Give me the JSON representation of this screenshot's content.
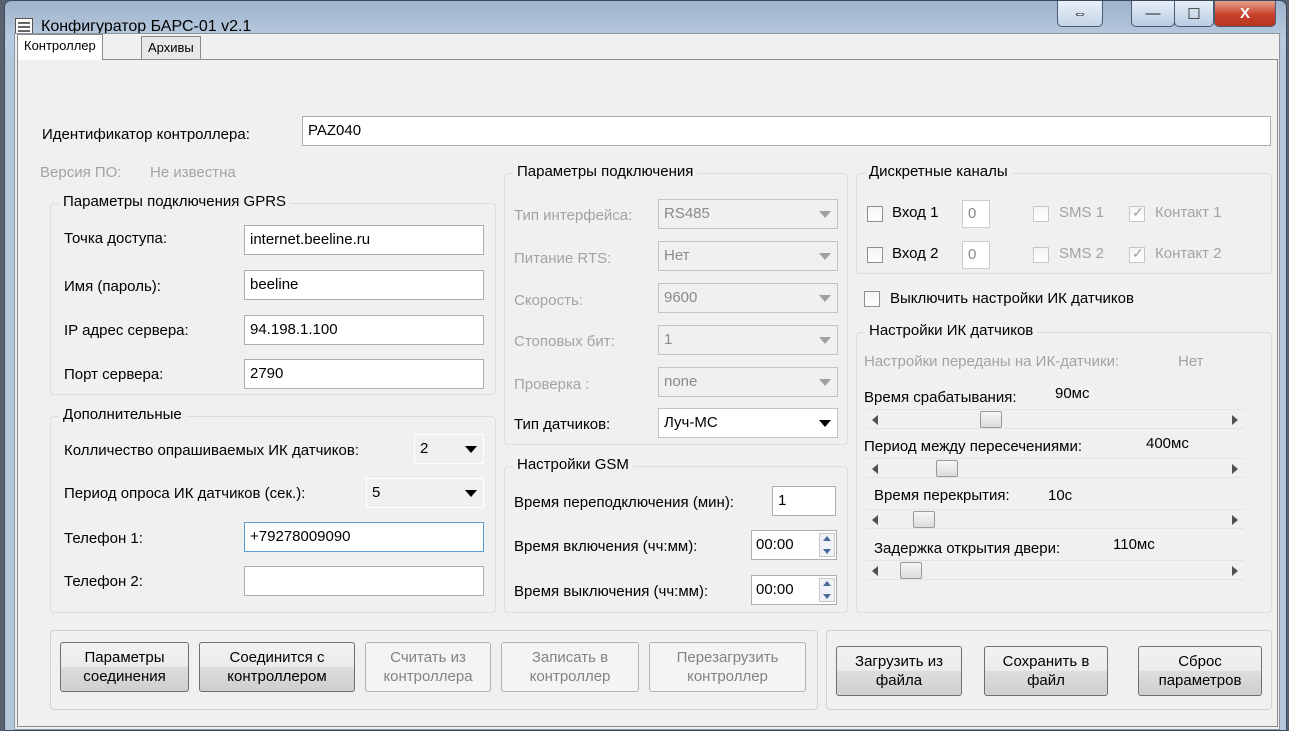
{
  "window": {
    "title": "Конфигуратор БАРС-01 v2.1",
    "caption_buttons": {
      "restore_size": "⇔",
      "minimize": "—",
      "maximize": "☐",
      "close": "X"
    }
  },
  "tabs": [
    {
      "label": "Контроллер"
    },
    {
      "label": "Архивы"
    }
  ],
  "controller_id": {
    "label": "Идентификатор контроллера:",
    "value": "PAZ040"
  },
  "firmware": {
    "label": "Версия ПО:",
    "value": "Не известна"
  },
  "gprs": {
    "title": "Параметры подключения GPRS",
    "apn_label": "Точка доступа:",
    "apn_value": "internet.beeline.ru",
    "user_label": "Имя (пароль):",
    "user_value": "beeline",
    "ip_label": "IP адрес сервера:",
    "ip_value": "94.198.1.100",
    "port_label": "Порт сервера:",
    "port_value": "2790"
  },
  "extra": {
    "title": "Дополнительные",
    "sensor_count_label": "Колличество опрашиваемых ИК датчиков:",
    "sensor_count_value": "2",
    "poll_period_label": "Период опроса ИК датчиков (сек.):",
    "poll_period_value": "5",
    "phone1_label": "Телефон 1:",
    "phone1_value": "+79278009090",
    "phone2_label": "Телефон 2:",
    "phone2_value": ""
  },
  "connection": {
    "title": "Параметры подключения",
    "iface_label": "Тип интерфейса:",
    "iface_value": "RS485",
    "rts_label": "Питание RTS:",
    "rts_value": "Нет",
    "speed_label": "Скорость:",
    "speed_value": "9600",
    "stopbits_label": "Стоповых бит:",
    "stopbits_value": "1",
    "parity_label": "Проверка :",
    "parity_value": "none",
    "sensor_type_label": "Тип датчиков:",
    "sensor_type_value": "Луч-МС"
  },
  "gsm": {
    "title": "Настройки GSM",
    "reconnect_label": "Время переподключения (мин):",
    "reconnect_value": "1",
    "on_label": "Время включения (чч:мм):",
    "on_value": "00:00",
    "off_label": "Время выключения (чч:мм):",
    "off_value": "00:00"
  },
  "discrete": {
    "title": "Дискретные каналы",
    "in1_label": "Вход 1",
    "in1_value": "0",
    "in2_label": "Вход 2",
    "in2_value": "0",
    "sms1_label": "SMS 1",
    "sms2_label": "SMS 2",
    "contact1_label": "Контакт 1",
    "contact2_label": "Контакт 2"
  },
  "ir_disable_label": "Выключить настройки ИК датчиков",
  "ir": {
    "title": "Настройки ИК датчиков",
    "transferred_label": "Настройки переданы на ИК-датчики:",
    "transferred_value": "Нет",
    "trigger_label": "Время срабатывания:",
    "trigger_value": "90мс",
    "trigger_level": 0.3,
    "period_label": "Период между пересечениями:",
    "period_value": "400мс",
    "period_level": 0.17,
    "overlap_label": "Время перекрытия:",
    "overlap_value": "10с",
    "overlap_level": 0.1,
    "door_label": "Задержка открытия двери:",
    "door_value": "110мс",
    "door_level": 0.06
  },
  "buttons": {
    "conn_params": "Параметры\nсоединения",
    "connect": "Соединится с\nконтроллером",
    "read": "Считать из\nконтроллера",
    "write": "Записать в\nконтроллер",
    "reboot": "Перезагрузить\nконтроллер",
    "load": "Загрузить из\nфайла",
    "save": "Сохранить в\nфайл",
    "reset": "Сброс\nпараметров"
  }
}
